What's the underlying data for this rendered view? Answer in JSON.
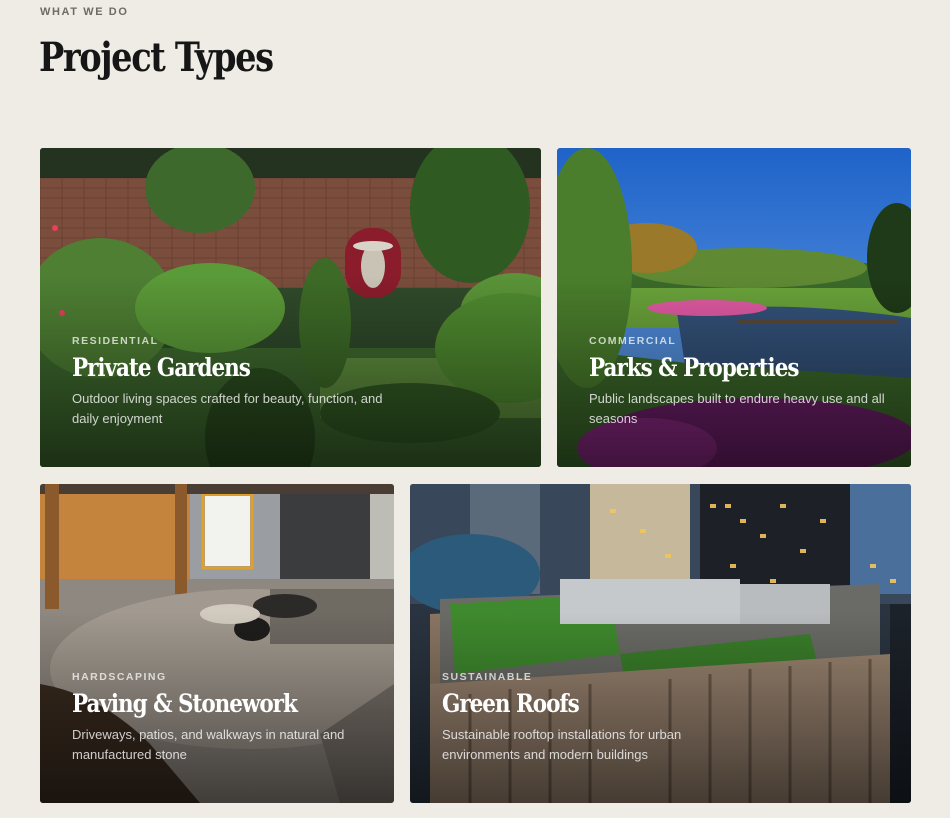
{
  "section": {
    "eyebrow": "WHAT WE DO",
    "title": "Project Types"
  },
  "cards": [
    {
      "category": "RESIDENTIAL",
      "title": "Private Gardens",
      "description": "Outdoor living spaces crafted for beauty, function, and daily enjoyment"
    },
    {
      "category": "COMMERCIAL",
      "title": "Parks & Properties",
      "description": "Public landscapes built to endure heavy use and all seasons"
    },
    {
      "category": "HARDSCAPING",
      "title": "Paving & Stonework",
      "description": "Driveways, patios, and walkways in natural and manufactured stone"
    },
    {
      "category": "SUSTAINABLE",
      "title": "Green Roofs",
      "description": "Sustainable rooftop installations for urban environments and modern buildings"
    }
  ]
}
